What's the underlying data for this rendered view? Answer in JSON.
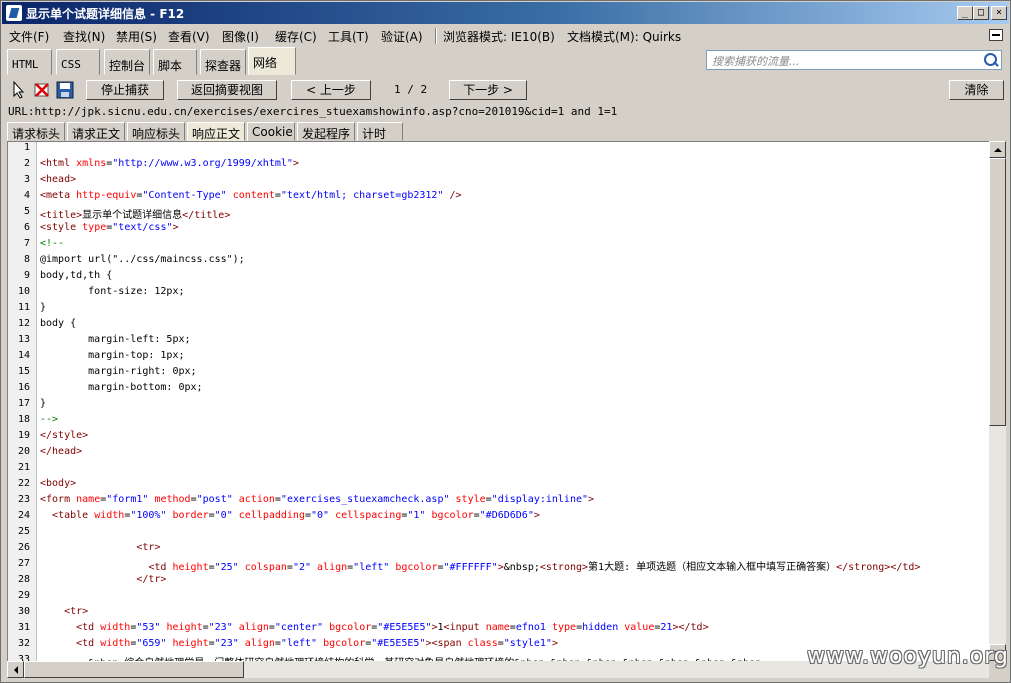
{
  "window": {
    "title": "显示单个试题详细信息 - F12"
  },
  "menu": {
    "items": [
      "文件(F)",
      "查找(N)",
      "禁用(S)",
      "查看(V)",
      "图像(I)",
      "缓存(C)",
      "工具(T)",
      "验证(A)"
    ],
    "browser_mode": "浏览器模式: IE10(B)",
    "document_mode": "文档模式(M): Quirks"
  },
  "tabs": [
    "HTML",
    "CSS",
    "控制台",
    "脚本",
    "探查器",
    "网络"
  ],
  "active_tab": "网络",
  "search": {
    "placeholder": "搜索捕获的流量..."
  },
  "toolbar": {
    "stop_capture": "停止捕获",
    "back_to_summary": "返回摘要视图",
    "prev": "< 上一步",
    "pager": "1 / 2",
    "next": "下一步 >",
    "clear": "清除"
  },
  "url_line": "URL:http://jpk.sicnu.edu.cn/exercises/exercires_stuexamshowinfo.asp?cno=201019&cid=1 and 1=1",
  "subtabs": [
    "请求标头",
    "请求正文",
    "响应标头",
    "响应正文",
    "Cookie",
    "发起程序",
    "计时"
  ],
  "active_subtab": "响应正文",
  "code_lines": [
    "",
    "<html xmlns=\"http://www.w3.org/1999/xhtml\">",
    "<head>",
    "<meta http-equiv=\"Content-Type\" content=\"text/html; charset=gb2312\" />",
    "<title>显示单个试题详细信息</title>",
    "<style type=\"text/css\">",
    "<!--",
    "@import url(\"../css/maincss.css\");",
    "body,td,th {",
    "        font-size: 12px;",
    "}",
    "body {",
    "        margin-left: 5px;",
    "        margin-top: 1px;",
    "        margin-right: 0px;",
    "        margin-bottom: 0px;",
    "}",
    "-->",
    "</style>",
    "</head>",
    "",
    "<body>",
    "<form name=\"form1\" method=\"post\" action=\"exercises_stuexamcheck.asp\" style=\"display:inline\">",
    "  <table width=\"100%\" border=\"0\" cellpadding=\"0\" cellspacing=\"1\" bgcolor=\"#D6D6D6\">",
    "",
    "                <tr>",
    "                  <td height=\"25\" colspan=\"2\" align=\"left\" bgcolor=\"#FFFFFF\">&nbsp;<strong>第1大题: 单项选题（相应文本输入框中填写正确答案）</strong></td>",
    "                </tr>",
    "",
    "    <tr>",
    "      <td width=\"53\" height=\"23\" align=\"center\" bgcolor=\"#E5E5E5\">1<input name=efno1 type=hidden value=21></td>",
    "      <td width=\"659\" height=\"23\" align=\"left\" bgcolor=\"#E5E5E5\"><span class=\"style1\">",
    "        &nbsp;综合自然地理学是一门整体研究自然地理环境结构的科学，其研究对象是自然地理环境的&nbsp;&nbsp;&nbsp;&nbsp;&nbsp;&nbsp;&nbsp;"
  ],
  "watermark": "www.wooyun.org",
  "colors": {
    "tag": "#800000",
    "attr": "#ff0000",
    "value": "#0000ff",
    "comment": "#008000"
  }
}
